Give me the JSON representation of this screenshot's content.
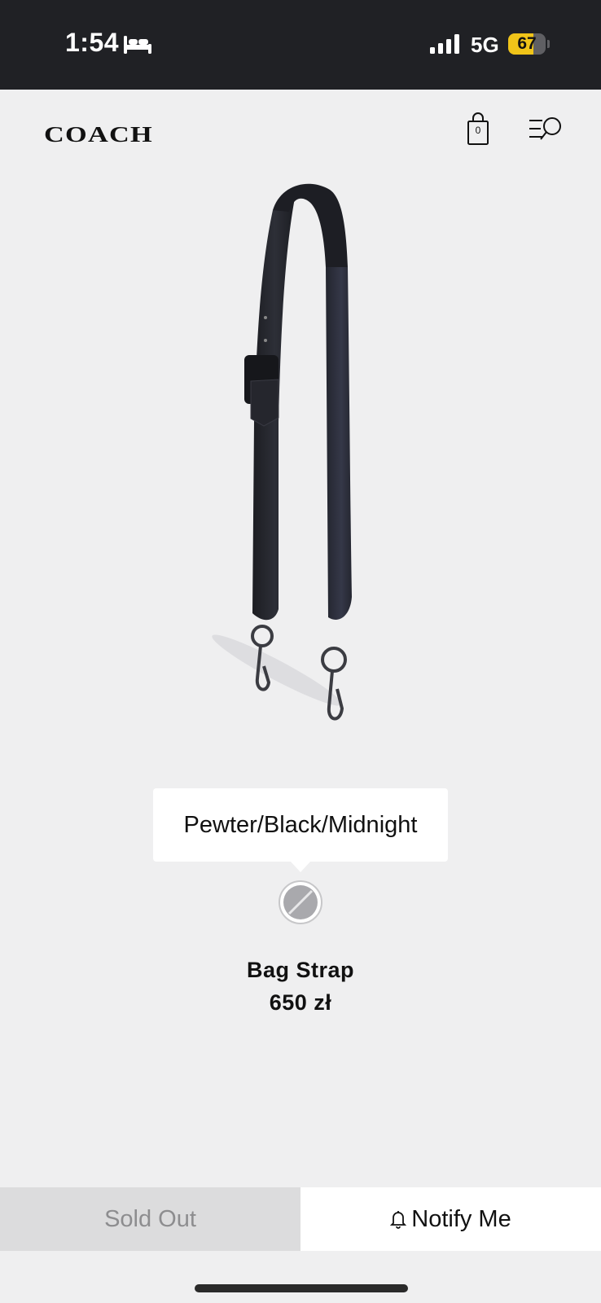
{
  "status_bar": {
    "time": "1:54",
    "network": "5G",
    "battery_level": "67",
    "battery_color": "#f0c419",
    "icons": [
      "bed-icon",
      "signal-icon",
      "battery-icon"
    ]
  },
  "header": {
    "logo": "COACH",
    "bag_count": "0",
    "icons": [
      "shopping-bag-icon",
      "menu-search-icon"
    ]
  },
  "product": {
    "image_icon": "bag-strap-image",
    "color_tooltip": "Pewter/Black/Midnight",
    "swatch_icon": "pewter-swatch-icon",
    "name": "Bag Strap",
    "price": "650 zł"
  },
  "actions": {
    "sold_out_label": "Sold Out",
    "notify_label": "Notify Me",
    "notify_icon": "bell-icon"
  },
  "colors": {
    "status_bar_bg": "#202125",
    "page_bg": "#efeff0",
    "sold_out_bg": "#dcdcdd",
    "sold_out_text": "#8d8d8f"
  }
}
